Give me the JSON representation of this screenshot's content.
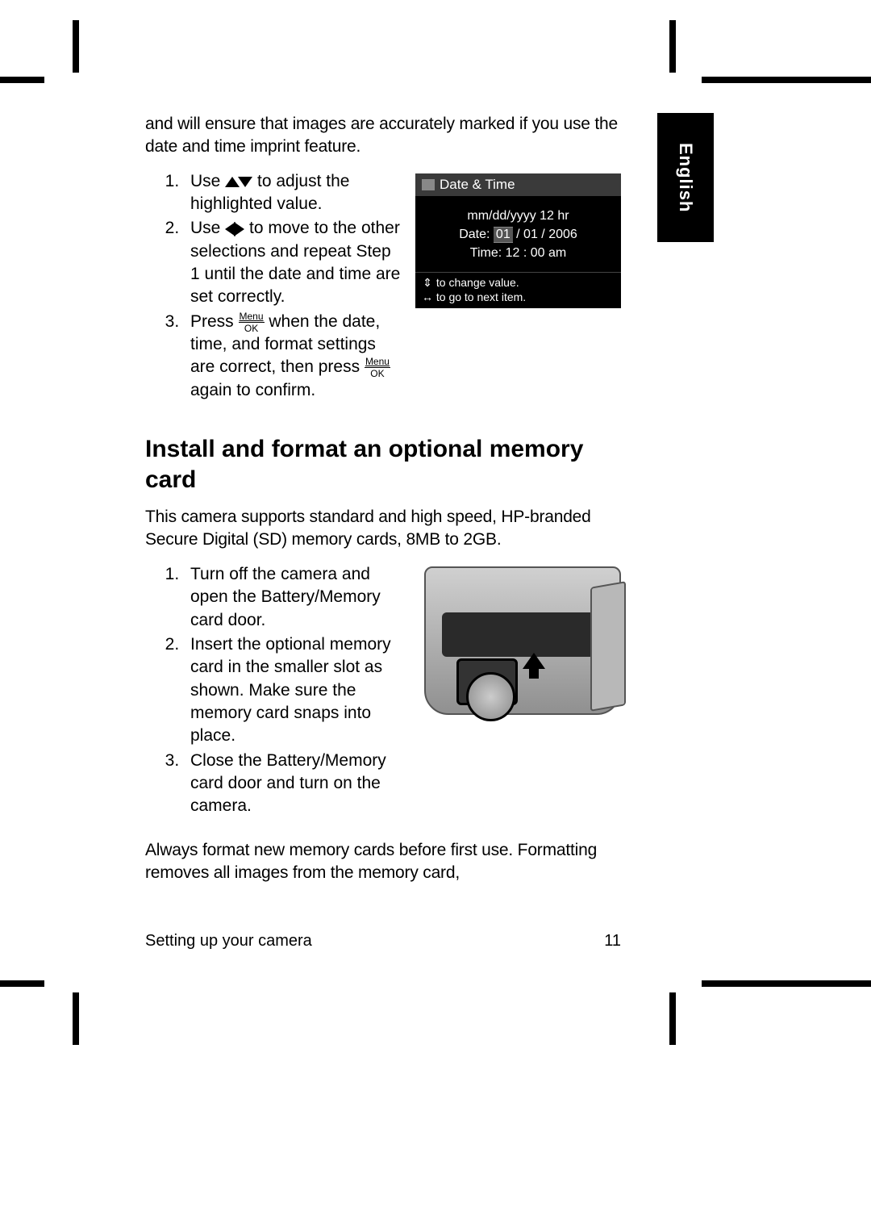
{
  "language_tab": "English",
  "intro_paragraph": "and will ensure that images are accurately marked if you use the date and time imprint feature.",
  "date_time_steps": {
    "s1a": "Use ",
    "s1b": " to adjust the highlighted value.",
    "s2a": "Use ",
    "s2b": " to move to the other selections and repeat Step 1 until the date and time are set correctly.",
    "s3a": "Press ",
    "s3b": " when the date, time, and format settings are correct, then press ",
    "s3c": " again to confirm."
  },
  "menu_ok": {
    "top": "Menu",
    "bottom": "OK"
  },
  "lcd": {
    "title": "Date & Time",
    "format_line": "mm/dd/yyyy  12 hr",
    "date_label": "Date:",
    "date_hl": "01",
    "date_rest": " / 01 / 2006",
    "time_label": "Time:",
    "time_value": "12 : 00  am",
    "footer1": "to change value.",
    "footer2": "to go to next item."
  },
  "heading": "Install and format an optional memory card",
  "memcard_intro": "This camera supports standard and high speed, HP-branded Secure Digital (SD) memory cards, 8MB to 2GB.",
  "memcard_steps": {
    "s1": "Turn off the camera and open the Battery/Memory card door.",
    "s2": "Insert the optional memory card in the smaller slot as shown. Make sure the memory card snaps into place.",
    "s3": "Close the Battery/Memory card door and turn on the camera."
  },
  "memcard_outro": "Always format new memory cards before first use. Formatting removes all images from the memory card,",
  "footer": {
    "section": "Setting up your camera",
    "page": "11"
  }
}
